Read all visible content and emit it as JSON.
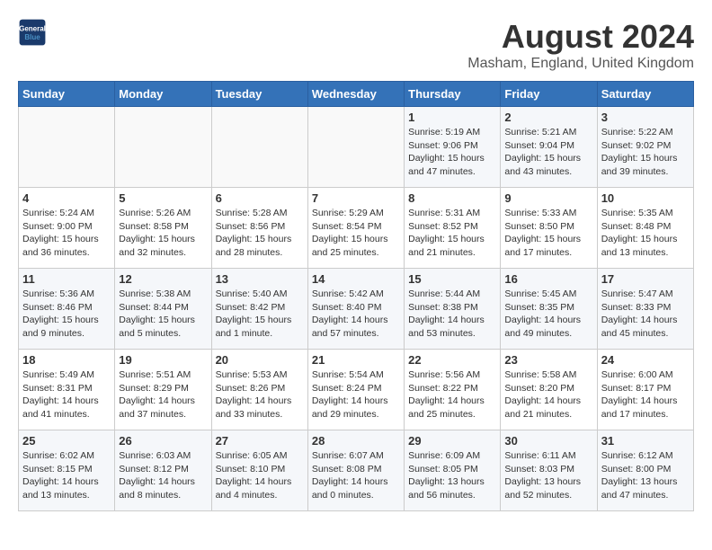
{
  "header": {
    "logo_line1": "General",
    "logo_line2": "Blue",
    "month_year": "August 2024",
    "location": "Masham, England, United Kingdom"
  },
  "weekdays": [
    "Sunday",
    "Monday",
    "Tuesday",
    "Wednesday",
    "Thursday",
    "Friday",
    "Saturday"
  ],
  "weeks": [
    [
      {
        "day": "",
        "info": ""
      },
      {
        "day": "",
        "info": ""
      },
      {
        "day": "",
        "info": ""
      },
      {
        "day": "",
        "info": ""
      },
      {
        "day": "1",
        "info": "Sunrise: 5:19 AM\nSunset: 9:06 PM\nDaylight: 15 hours\nand 47 minutes."
      },
      {
        "day": "2",
        "info": "Sunrise: 5:21 AM\nSunset: 9:04 PM\nDaylight: 15 hours\nand 43 minutes."
      },
      {
        "day": "3",
        "info": "Sunrise: 5:22 AM\nSunset: 9:02 PM\nDaylight: 15 hours\nand 39 minutes."
      }
    ],
    [
      {
        "day": "4",
        "info": "Sunrise: 5:24 AM\nSunset: 9:00 PM\nDaylight: 15 hours\nand 36 minutes."
      },
      {
        "day": "5",
        "info": "Sunrise: 5:26 AM\nSunset: 8:58 PM\nDaylight: 15 hours\nand 32 minutes."
      },
      {
        "day": "6",
        "info": "Sunrise: 5:28 AM\nSunset: 8:56 PM\nDaylight: 15 hours\nand 28 minutes."
      },
      {
        "day": "7",
        "info": "Sunrise: 5:29 AM\nSunset: 8:54 PM\nDaylight: 15 hours\nand 25 minutes."
      },
      {
        "day": "8",
        "info": "Sunrise: 5:31 AM\nSunset: 8:52 PM\nDaylight: 15 hours\nand 21 minutes."
      },
      {
        "day": "9",
        "info": "Sunrise: 5:33 AM\nSunset: 8:50 PM\nDaylight: 15 hours\nand 17 minutes."
      },
      {
        "day": "10",
        "info": "Sunrise: 5:35 AM\nSunset: 8:48 PM\nDaylight: 15 hours\nand 13 minutes."
      }
    ],
    [
      {
        "day": "11",
        "info": "Sunrise: 5:36 AM\nSunset: 8:46 PM\nDaylight: 15 hours\nand 9 minutes."
      },
      {
        "day": "12",
        "info": "Sunrise: 5:38 AM\nSunset: 8:44 PM\nDaylight: 15 hours\nand 5 minutes."
      },
      {
        "day": "13",
        "info": "Sunrise: 5:40 AM\nSunset: 8:42 PM\nDaylight: 15 hours\nand 1 minute."
      },
      {
        "day": "14",
        "info": "Sunrise: 5:42 AM\nSunset: 8:40 PM\nDaylight: 14 hours\nand 57 minutes."
      },
      {
        "day": "15",
        "info": "Sunrise: 5:44 AM\nSunset: 8:38 PM\nDaylight: 14 hours\nand 53 minutes."
      },
      {
        "day": "16",
        "info": "Sunrise: 5:45 AM\nSunset: 8:35 PM\nDaylight: 14 hours\nand 49 minutes."
      },
      {
        "day": "17",
        "info": "Sunrise: 5:47 AM\nSunset: 8:33 PM\nDaylight: 14 hours\nand 45 minutes."
      }
    ],
    [
      {
        "day": "18",
        "info": "Sunrise: 5:49 AM\nSunset: 8:31 PM\nDaylight: 14 hours\nand 41 minutes."
      },
      {
        "day": "19",
        "info": "Sunrise: 5:51 AM\nSunset: 8:29 PM\nDaylight: 14 hours\nand 37 minutes."
      },
      {
        "day": "20",
        "info": "Sunrise: 5:53 AM\nSunset: 8:26 PM\nDaylight: 14 hours\nand 33 minutes."
      },
      {
        "day": "21",
        "info": "Sunrise: 5:54 AM\nSunset: 8:24 PM\nDaylight: 14 hours\nand 29 minutes."
      },
      {
        "day": "22",
        "info": "Sunrise: 5:56 AM\nSunset: 8:22 PM\nDaylight: 14 hours\nand 25 minutes."
      },
      {
        "day": "23",
        "info": "Sunrise: 5:58 AM\nSunset: 8:20 PM\nDaylight: 14 hours\nand 21 minutes."
      },
      {
        "day": "24",
        "info": "Sunrise: 6:00 AM\nSunset: 8:17 PM\nDaylight: 14 hours\nand 17 minutes."
      }
    ],
    [
      {
        "day": "25",
        "info": "Sunrise: 6:02 AM\nSunset: 8:15 PM\nDaylight: 14 hours\nand 13 minutes."
      },
      {
        "day": "26",
        "info": "Sunrise: 6:03 AM\nSunset: 8:12 PM\nDaylight: 14 hours\nand 8 minutes."
      },
      {
        "day": "27",
        "info": "Sunrise: 6:05 AM\nSunset: 8:10 PM\nDaylight: 14 hours\nand 4 minutes."
      },
      {
        "day": "28",
        "info": "Sunrise: 6:07 AM\nSunset: 8:08 PM\nDaylight: 14 hours\nand 0 minutes."
      },
      {
        "day": "29",
        "info": "Sunrise: 6:09 AM\nSunset: 8:05 PM\nDaylight: 13 hours\nand 56 minutes."
      },
      {
        "day": "30",
        "info": "Sunrise: 6:11 AM\nSunset: 8:03 PM\nDaylight: 13 hours\nand 52 minutes."
      },
      {
        "day": "31",
        "info": "Sunrise: 6:12 AM\nSunset: 8:00 PM\nDaylight: 13 hours\nand 47 minutes."
      }
    ]
  ]
}
